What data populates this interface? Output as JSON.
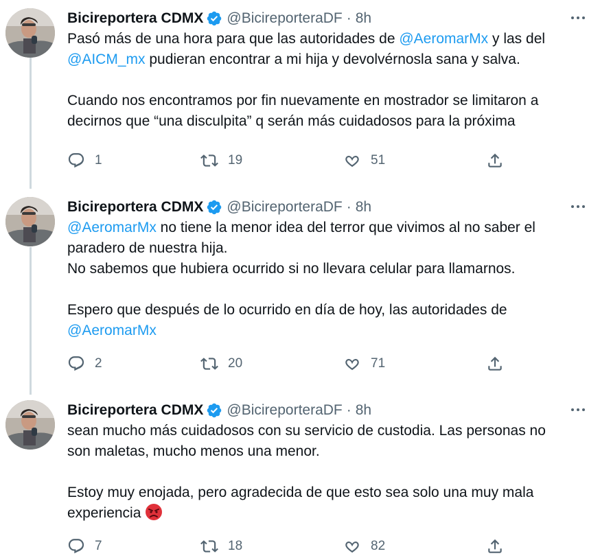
{
  "author": {
    "name": "Bicireportera CDMX",
    "handle": "@BicireporteraDF",
    "separator": "·"
  },
  "tweets": [
    {
      "time": "8h",
      "lines": [
        [
          {
            "t": "Pasó más de una hora para que las autoridades de "
          },
          {
            "t": "@AeromarMx",
            "m": true
          },
          {
            "t": " y las del"
          }
        ],
        [
          {
            "t": "@AICM_mx",
            "m": true
          },
          {
            "t": " pudieran encontrar a mi hija y devolvérnosla sana y salva."
          }
        ],
        [],
        [
          {
            "t": "Cuando nos encontramos por fin nuevamente en mostrador se limitaron a"
          }
        ],
        [
          {
            "t": "decirnos que “una disculpita” q serán más cuidadosos para la próxima"
          }
        ]
      ],
      "replies": "1",
      "retweets": "19",
      "likes": "51"
    },
    {
      "time": "8h",
      "lines": [
        [
          {
            "t": "@AeromarMx",
            "m": true
          },
          {
            "t": " no tiene la menor idea del terror que vivimos al no saber el"
          }
        ],
        [
          {
            "t": "paradero de nuestra hija."
          }
        ],
        [
          {
            "t": "No sabemos que hubiera ocurrido si no llevara celular para llamarnos."
          }
        ],
        [],
        [
          {
            "t": "Espero que después de lo ocurrido en día de hoy, las autoridades de"
          }
        ],
        [
          {
            "t": "@AeromarMx",
            "m": true
          }
        ]
      ],
      "replies": "2",
      "retweets": "20",
      "likes": "71"
    },
    {
      "time": "8h",
      "lines": [
        [
          {
            "t": "sean mucho más cuidadosos con su servicio de custodia. Las personas no"
          }
        ],
        [
          {
            "t": "son maletas, mucho menos una menor."
          }
        ],
        [],
        [
          {
            "t": "Estoy muy enojada, pero agradecida de que esto sea solo una muy mala"
          }
        ],
        [
          {
            "t": "experiencia "
          },
          {
            "emoji": "angry-face"
          }
        ]
      ],
      "replies": "7",
      "retweets": "18",
      "likes": "82"
    }
  ],
  "icons": {
    "verified": "verified-badge-icon",
    "more": "more-options-icon",
    "reply": "reply-icon",
    "retweet": "retweet-icon",
    "like": "like-icon",
    "share": "share-icon"
  },
  "colors": {
    "mention": "#1d9bf0",
    "muted": "#536471",
    "verified": "#1d9bf0",
    "thread_line": "#cfd9de",
    "angry_emoji": "#e0313a"
  }
}
